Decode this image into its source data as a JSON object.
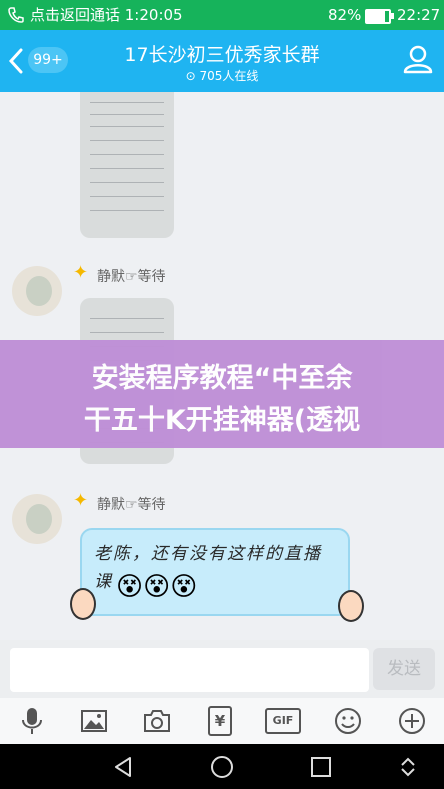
{
  "status_bar": {
    "back_label": "点击返回通话 1:20:05",
    "battery": "82%",
    "time": "22:27"
  },
  "header": {
    "badge": "99+",
    "title": "17长沙初三优秀家长群",
    "online": "705人在线"
  },
  "messages": [
    {
      "sender": "静默☞等待"
    },
    {
      "sender": "静默☞等待",
      "text": "老陈，还有没有这样的直播课",
      "emoji": "😵😵😵"
    }
  ],
  "overlay": {
    "line1": "安装程序教程“中至余",
    "line2": "干五十K开挂神器(透视"
  },
  "input": {
    "placeholder": "",
    "send_label": "发送"
  },
  "toolbar": {
    "icons": [
      "microphone-icon",
      "image-icon",
      "camera-icon",
      "red-packet-icon",
      "gif-icon",
      "emoji-icon",
      "plus-icon"
    ],
    "red_packet_label": "¥",
    "gif_label": "GIF"
  },
  "colors": {
    "status_bar": "#16b35b",
    "header": "#1fb4f1",
    "overlay": "#bf8fd7",
    "bubble": "#c7ecfb"
  }
}
